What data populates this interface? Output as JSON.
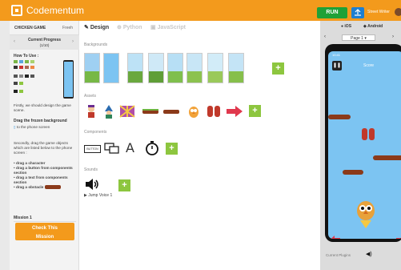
{
  "app": {
    "title": "Codementum",
    "run_label": "RUN",
    "user_name": "Street Writer"
  },
  "left_panel": {
    "tab_active": "CHICKEN GAME",
    "tab_free": "Freeh",
    "progress_title": "Current Progress",
    "progress_count": "(1/10)",
    "howto_label": "How To Use :",
    "intro_text": "Firstly, we should design the game scene.",
    "step1_bold": "Drag the frozen background",
    "step1_rest": "to the phone screen",
    "step2_intro": "Secondly, drag the game objects which are listed below to the phone screen :",
    "step2_items": [
      "drag a character",
      "drag a button from components section",
      "drag a text from components section",
      "drag a obstacle"
    ],
    "mission_label": "Mission 1",
    "check_button_line1": "Check This",
    "check_button_line2": "Mission"
  },
  "tabs": {
    "design": "Design",
    "python": "Python",
    "javascript": "JavaScript"
  },
  "sections": {
    "backgrounds": "Backgrounds",
    "assets": "Assets",
    "components": "Components",
    "sounds": "Sounds"
  },
  "components": {
    "button_label": "BUTTON",
    "text_label": "A"
  },
  "sounds": {
    "item_label": "Jump Voice 1"
  },
  "preview": {
    "ios_label": "iOS",
    "android_label": "Android",
    "page_label": "Page 1",
    "status_time": "10:41",
    "score_label": "Score",
    "current_plugins": "Current Plugins"
  },
  "colors": {
    "brand": "#f39a1c",
    "run": "#1fa137",
    "upload": "#1e7fd1",
    "add": "#8dc63f",
    "sky": "#7cc4f2"
  }
}
